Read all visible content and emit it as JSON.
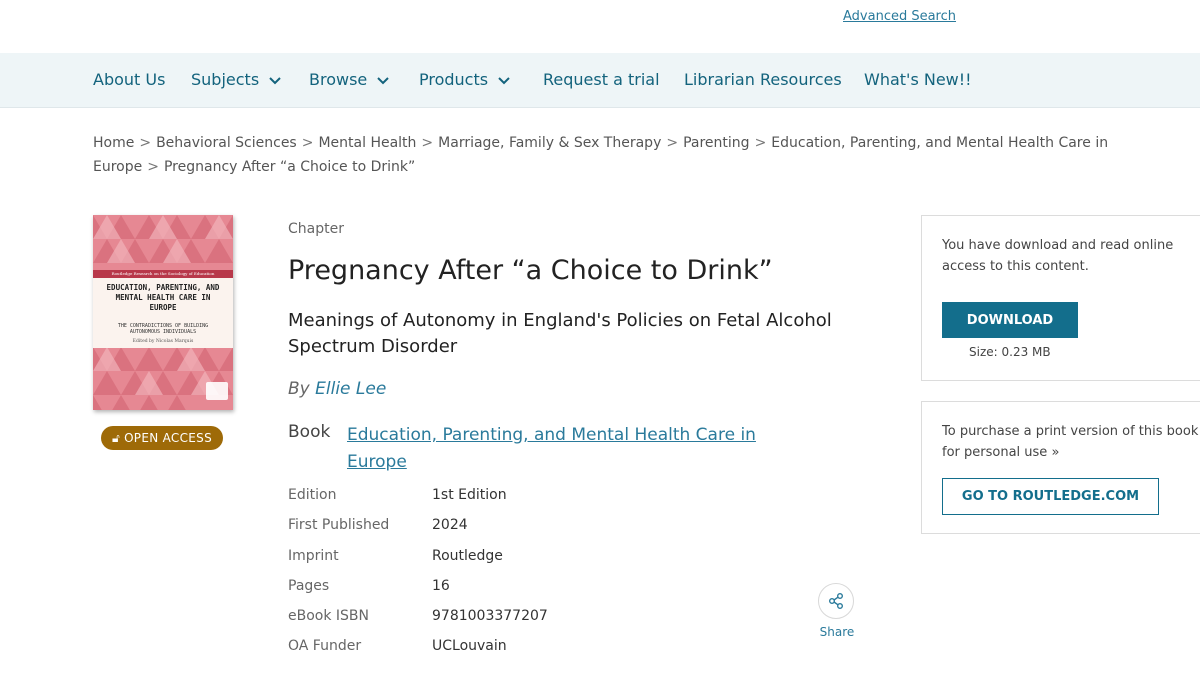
{
  "header": {
    "advanced_search": "Advanced Search"
  },
  "nav": {
    "items": [
      {
        "label": "About Us",
        "dropdown": false
      },
      {
        "label": "Subjects",
        "dropdown": true
      },
      {
        "label": "Browse",
        "dropdown": true
      },
      {
        "label": "Products",
        "dropdown": true
      },
      {
        "label": "Request a trial",
        "dropdown": false
      },
      {
        "label": "Librarian Resources",
        "dropdown": false
      },
      {
        "label": "What's New!!",
        "dropdown": false
      }
    ]
  },
  "breadcrumb": {
    "items": [
      "Home",
      "Behavioral Sciences",
      "Mental Health",
      "Marriage, Family & Sex Therapy",
      "Parenting",
      "Education, Parenting, and Mental Health Care in Europe",
      "Pregnancy After “a Choice to Drink”"
    ],
    "separator": ">"
  },
  "cover": {
    "series": "Routledge Research on the Sociology of Education",
    "title": "EDUCATION, PARENTING, AND MENTAL HEALTH CARE IN EUROPE",
    "subtitle": "THE CONTRADICTIONS OF BUILDING AUTONOMOUS INDIVIDUALS",
    "editor": "Edited by Nicolas Marquis"
  },
  "badge": {
    "label": "OPEN ACCESS"
  },
  "chapter": {
    "type_label": "Chapter",
    "title": "Pregnancy After “a Choice to Drink”",
    "subtitle": "Meanings of Autonomy in England's Policies on Fetal Alcohol Spectrum Disorder",
    "by_prefix": "By",
    "author": "Ellie Lee",
    "book_label": "Book",
    "book_title": "Education, Parenting, and Mental Health Care in Europe"
  },
  "meta": [
    {
      "key": "Edition",
      "value": "1st Edition"
    },
    {
      "key": "First Published",
      "value": "2024"
    },
    {
      "key": "Imprint",
      "value": "Routledge"
    },
    {
      "key": "Pages",
      "value": "16"
    },
    {
      "key": "eBook ISBN",
      "value": "9781003377207"
    },
    {
      "key": "OA Funder",
      "value": "UCLouvain"
    }
  ],
  "share": {
    "label": "Share"
  },
  "download_panel": {
    "text": "You have download and read online access to this content.",
    "button": "DOWNLOAD",
    "size": "Size: 0.23 MB"
  },
  "purchase_panel": {
    "text": "To purchase a print version of this book for personal use",
    "button": "GO TO ROUTLEDGE.COM"
  },
  "colors": {
    "accent": "#136e8c",
    "link": "#2a7a9b",
    "nav_bg": "#eef5f7",
    "badge": "#9e6a08"
  }
}
